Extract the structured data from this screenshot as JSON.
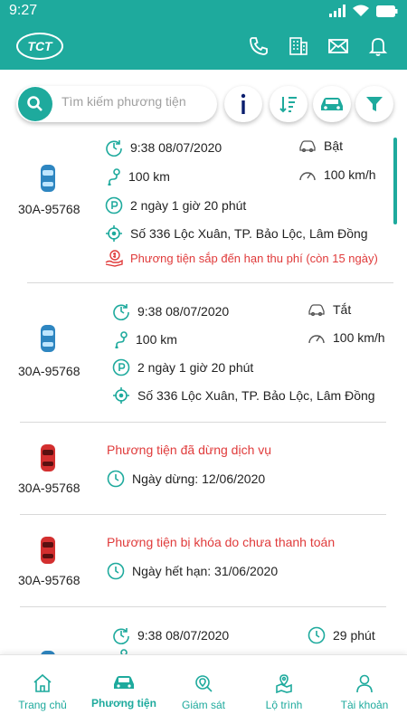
{
  "status_bar": {
    "time": "9:27"
  },
  "header": {
    "logo_text": "TCT",
    "actions": [
      "phone-icon",
      "building-icon",
      "mail-icon",
      "bell-icon"
    ]
  },
  "search": {
    "placeholder": "Tìm kiếm phương tiện"
  },
  "colors": {
    "primary": "#1eaa9d",
    "warning": "#e03b3b",
    "car_blue": "#2e86c1",
    "car_red": "#d32f2f"
  },
  "vehicles": [
    {
      "plate": "30A-95768",
      "car_color": "blue",
      "datetime": "9:38 08/07/2020",
      "engine": "Bật",
      "distance": "100 km",
      "speed": "100 km/h",
      "parking": "2 ngày 1 giờ 20 phút",
      "address": "Số 336 Lộc Xuân, TP. Bảo Lộc, Lâm Đồng",
      "warning": "Phương tiện sắp đến hạn thu phí (còn 15 ngày)"
    },
    {
      "plate": "30A-95768",
      "car_color": "blue",
      "datetime": "9:38 08/07/2020",
      "engine": "Tắt",
      "distance": "100 km",
      "speed": "100 km/h",
      "parking": "2 ngày 1 giờ 20 phút",
      "address": "Số 336 Lộc Xuân, TP. Bảo Lộc, Lâm Đồng"
    },
    {
      "plate": "30A-95768",
      "car_color": "red",
      "status": "Phương tiện đã dừng dịch vụ",
      "date_label": "Ngày dừng: 12/06/2020"
    },
    {
      "plate": "30A-95768",
      "car_color": "red",
      "status": "Phương tiện bị khóa do chưa thanh toán",
      "date_label": "Ngày hết hạn: 31/06/2020"
    },
    {
      "datetime": "9:38 08/07/2020",
      "duration": "29 phút"
    }
  ],
  "bottom_nav": [
    {
      "label": "Trang chủ",
      "icon": "home-icon"
    },
    {
      "label": "Phương tiện",
      "icon": "car-icon",
      "active": true
    },
    {
      "label": "Giám sát",
      "icon": "monitor-icon"
    },
    {
      "label": "Lộ trình",
      "icon": "route-icon"
    },
    {
      "label": "Tài khoản",
      "icon": "account-icon"
    }
  ]
}
